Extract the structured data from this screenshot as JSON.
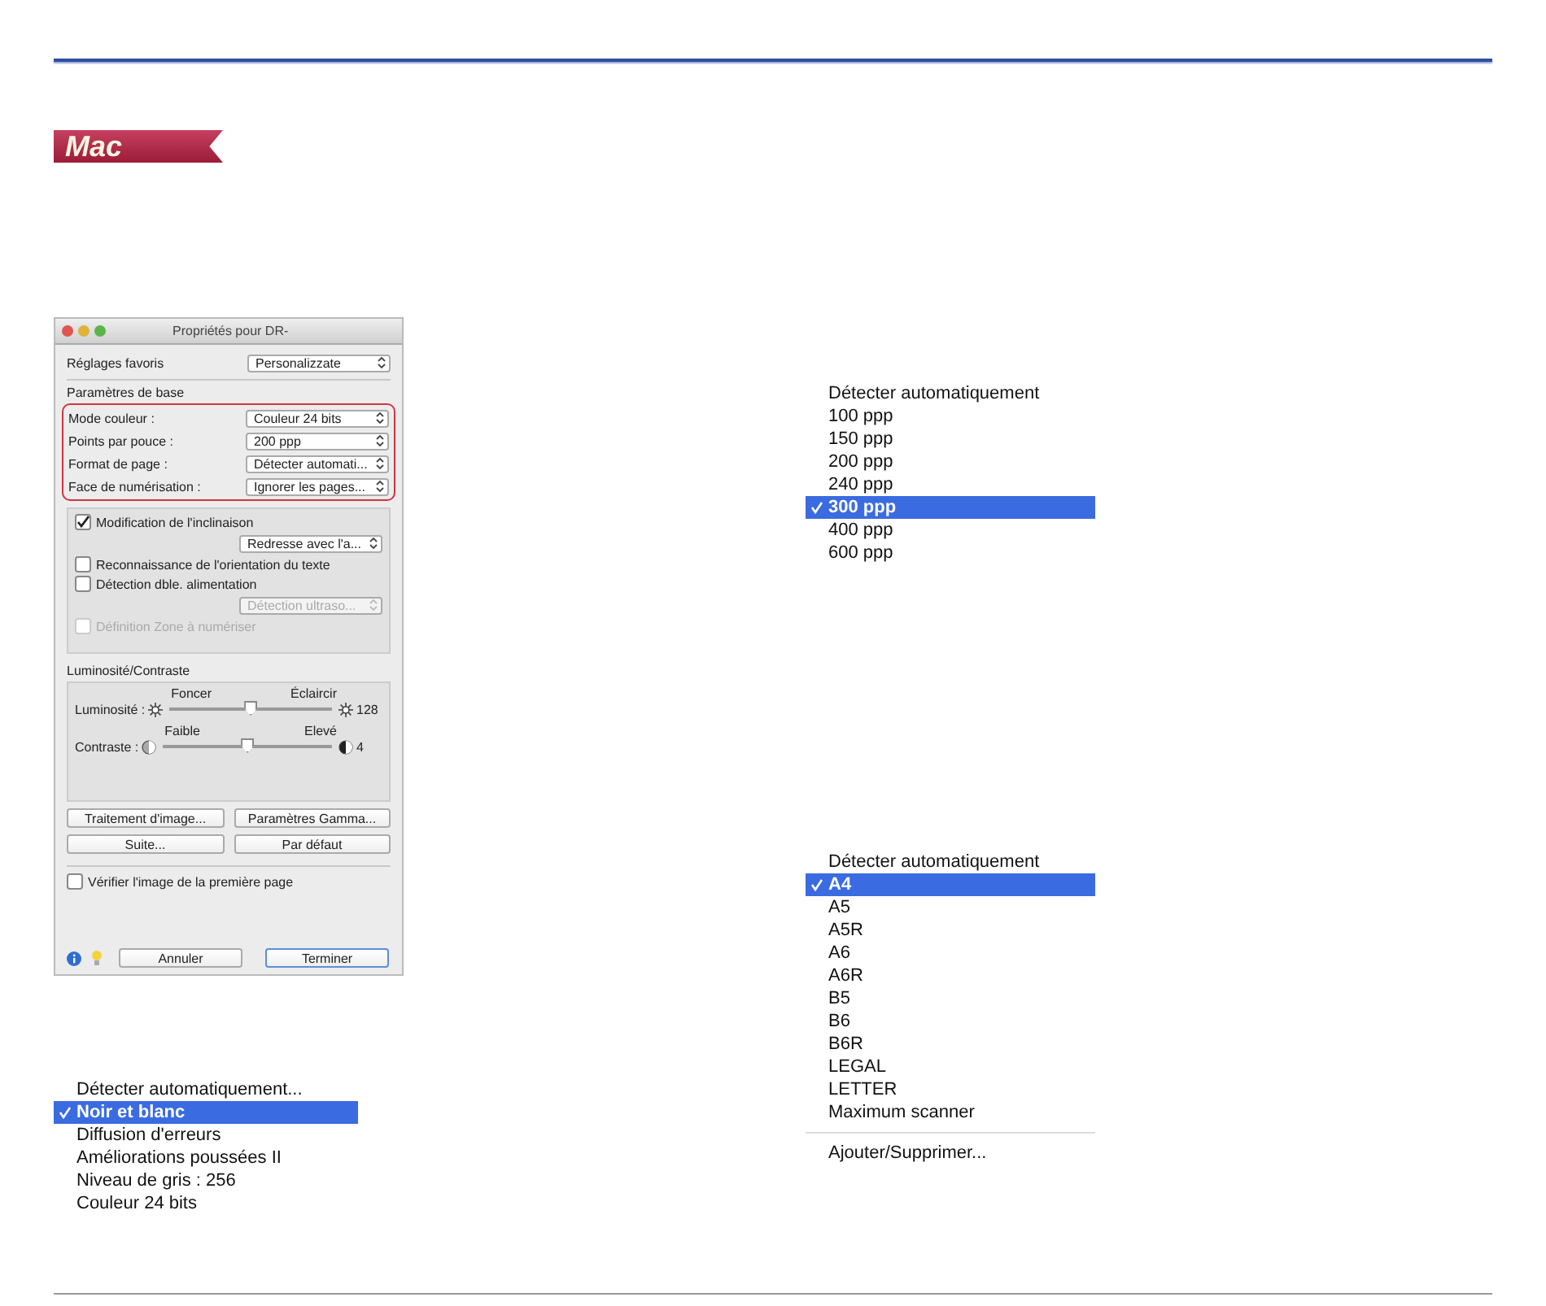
{
  "badge": "Mac",
  "dialog": {
    "title": "Propriétés pour DR-",
    "favorites": {
      "label": "Réglages favoris",
      "value": "Personalizzate"
    },
    "basic_section": "Paramètres de base",
    "basic_settings": [
      {
        "label": "Mode couleur :",
        "value": "Couleur 24 bits"
      },
      {
        "label": "Points par pouce :",
        "value": "200 ppp"
      },
      {
        "label": "Format de page :",
        "value": "Détecter automati..."
      },
      {
        "label": "Face de numérisation :",
        "value": "Ignorer les pages..."
      }
    ],
    "options": [
      {
        "kind": "check",
        "label": "Modification de l'inclinaison",
        "checked": true,
        "disabled": false
      },
      {
        "kind": "select",
        "value": "Redresse avec l'a...",
        "disabled": false
      },
      {
        "kind": "check",
        "label": "Reconnaissance de l'orientation du texte",
        "checked": false,
        "disabled": false
      },
      {
        "kind": "check",
        "label": "Détection dble. alimentation",
        "checked": false,
        "disabled": false
      },
      {
        "kind": "select",
        "value": "Détection ultraso...",
        "disabled": true
      },
      {
        "kind": "check",
        "label": "Définition Zone à numériser",
        "checked": false,
        "disabled": true
      }
    ],
    "brightness_section": "Luminosité/Contraste",
    "sliders": [
      {
        "kind": "brightness",
        "label": "Luminosité :",
        "left": "Foncer",
        "right": "Éclaircir",
        "reading": "128",
        "level": 0.5
      },
      {
        "kind": "contrast",
        "label": "Contraste :",
        "left": "Faible",
        "right": "Elevé",
        "reading": "4",
        "level": 0.5
      }
    ],
    "buttons": [
      "Traitement d'image...",
      "Paramètres Gamma...",
      "Suite...",
      "Par défaut"
    ],
    "verify": {
      "label": "Vérifier l'image de la première page",
      "checked": false
    },
    "footer_buttons": [
      {
        "label": "Annuler",
        "default": false
      },
      {
        "label": "Terminer",
        "default": true
      }
    ]
  },
  "menus": [
    {
      "items": [
        {
          "kind": "item",
          "label": "Détecter automatiquement",
          "selected": false
        },
        {
          "kind": "item",
          "label": "100 ppp",
          "selected": false
        },
        {
          "kind": "item",
          "label": "150 ppp",
          "selected": false
        },
        {
          "kind": "item",
          "label": "200 ppp",
          "selected": false
        },
        {
          "kind": "item",
          "label": "240 ppp",
          "selected": false
        },
        {
          "kind": "item",
          "label": "300 ppp",
          "selected": true
        },
        {
          "kind": "item",
          "label": "400 ppp",
          "selected": false
        },
        {
          "kind": "item",
          "label": "600 ppp",
          "selected": false
        }
      ]
    },
    {
      "items": [
        {
          "kind": "item",
          "label": "Détecter automatiquement",
          "selected": false
        },
        {
          "kind": "item",
          "label": "A4",
          "selected": true
        },
        {
          "kind": "item",
          "label": "A5",
          "selected": false
        },
        {
          "kind": "item",
          "label": "A5R",
          "selected": false
        },
        {
          "kind": "item",
          "label": "A6",
          "selected": false
        },
        {
          "kind": "item",
          "label": "A6R",
          "selected": false
        },
        {
          "kind": "item",
          "label": "B5",
          "selected": false
        },
        {
          "kind": "item",
          "label": "B6",
          "selected": false
        },
        {
          "kind": "item",
          "label": "B6R",
          "selected": false
        },
        {
          "kind": "item",
          "label": "LEGAL",
          "selected": false
        },
        {
          "kind": "item",
          "label": "LETTER",
          "selected": false
        },
        {
          "kind": "item",
          "label": "Maximum scanner",
          "selected": false
        },
        {
          "kind": "separator"
        },
        {
          "kind": "item",
          "label": "Ajouter/Supprimer...",
          "selected": false
        }
      ]
    },
    {
      "items": [
        {
          "kind": "item",
          "label": "Détecter automatiquement...",
          "selected": false
        },
        {
          "kind": "item",
          "label": "Noir et blanc",
          "selected": true
        },
        {
          "kind": "item",
          "label": "Diffusion d'erreurs",
          "selected": false
        },
        {
          "kind": "item",
          "label": "Améliorations poussées II",
          "selected": false
        },
        {
          "kind": "item",
          "label": "Niveau de gris : 256",
          "selected": false
        },
        {
          "kind": "item",
          "label": "Couleur 24 bits",
          "selected": false
        }
      ]
    }
  ]
}
